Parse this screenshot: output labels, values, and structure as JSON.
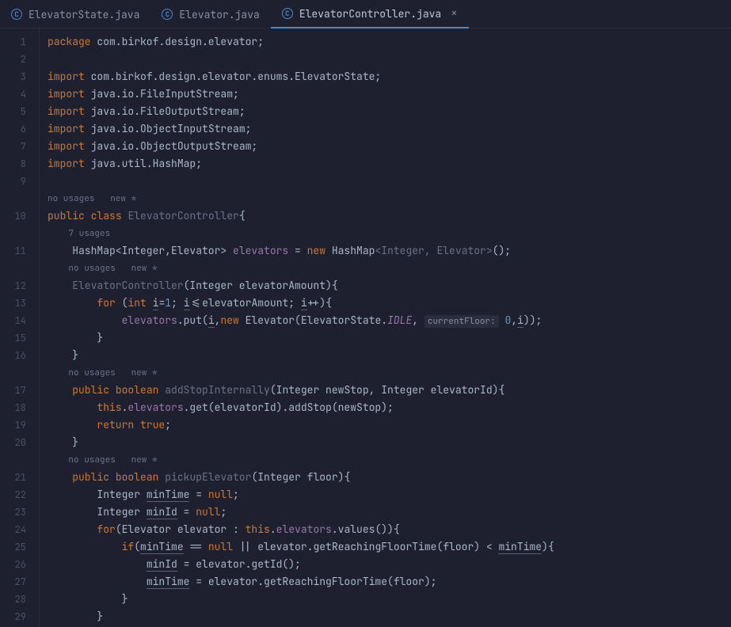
{
  "tabs": [
    {
      "label": "ElevatorState.java",
      "icon": "C",
      "active": false
    },
    {
      "label": "Elevator.java",
      "icon": "C",
      "active": false
    },
    {
      "label": "ElevatorController.java",
      "icon": "C",
      "active": true
    }
  ],
  "closeGlyph": "×",
  "gutter": [
    "1",
    "2",
    "3",
    "4",
    "5",
    "6",
    "7",
    "8",
    "9",
    "",
    "10",
    "",
    "11",
    "",
    "12",
    "13",
    "14",
    "15",
    "16",
    "",
    "17",
    "18",
    "19",
    "20",
    "",
    "21",
    "22",
    "23",
    "24",
    "25",
    "26",
    "27",
    "28",
    "29"
  ],
  "hints": {
    "noUsagesNew": "no usages   new *",
    "usages7": "7 usages",
    "currentFloor": "currentFloor:"
  },
  "code": {
    "pkg_kw": "package",
    "pkg_name": " com.birkof.design.elevator;",
    "import_kw": "import",
    "imp1": " com.birkof.design.elevator.enums.ElevatorState;",
    "imp2": " java.io.FileInputStream;",
    "imp3": " java.io.FileOutputStream;",
    "imp4": " java.io.ObjectInputStream;",
    "imp5": " java.io.ObjectOutputStream;",
    "imp6": " java.util.HashMap;",
    "public_kw": "public",
    "class_kw": "class",
    "className": "ElevatorController",
    "hashmap_decl_1": "HashMap<Integer,Elevator> ",
    "elevators_field": "elevators",
    "eq_new": " = ",
    "new_kw": "new",
    "hashmap_decl_2": " HashMap",
    "hashmap_generics": "<Integer, Elevator>",
    "hashmap_tail": "();",
    "ctor_name": "ElevatorController",
    "ctor_params": "(Integer elevatorAmount){",
    "for_kw": "for",
    "int_kw": "int",
    "for_open": " (",
    "i_var": "i",
    "for_eq1": "=",
    "one": "1",
    "for_semi": "; ",
    "for_cond": "<=elevatorAmount; ",
    "for_inc": "++){",
    "put_pre": ".put(",
    "put_comma": ",",
    "elevator_ctor": " Elevator(ElevatorState.",
    "idle": "IDLE",
    "comma_sp": ", ",
    "zero": "0",
    "put_tail": "));",
    "close_brace": "}",
    "boolean_kw": "boolean",
    "addStop_name": "addStopInternally",
    "addStop_params": "(Integer newStop, Integer elevatorId){",
    "this_kw": "this",
    "addStop_body": ".get(elevatorId).addStop(newStop);",
    "return_kw": "return",
    "true_kw": "true",
    "semi": ";",
    "pickup_name": "pickupElevator",
    "pickup_params": "(Integer floor){",
    "integer_type": "Integer ",
    "minTime": "minTime",
    "minId": "minId",
    "eq_null": " = ",
    "null_kw": "null",
    "for2_open": "(Elevator elevator : ",
    "for2_tail": ".values()){",
    "if_kw": "if",
    "if_open": "(",
    "eqeq": " == ",
    "or_op": " || elevator.getReachingFloorTime(floor) < ",
    "if_tail": "){",
    "minId_body": " = elevator.getId();",
    "minTime_body": " = elevator.getReachingFloorTime(floor);",
    "dot": "."
  }
}
